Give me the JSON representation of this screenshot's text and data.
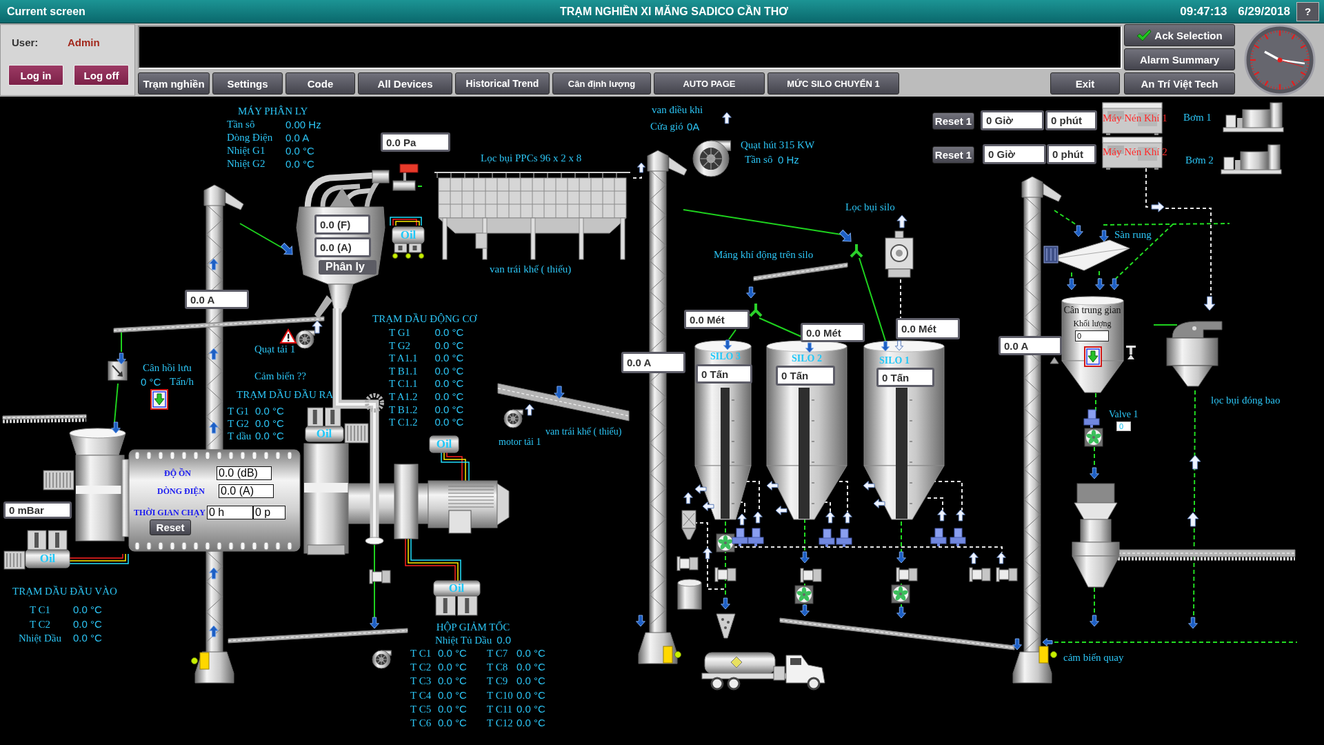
{
  "header": {
    "screen_label": "Current screen",
    "title": "TRẠM NGHIỀN XI MĂNG SADICO CẦN THƠ",
    "time": "09:47:13",
    "date": "6/29/2018",
    "help_button": "?"
  },
  "user_panel": {
    "user_label": "User:",
    "user_name": "Admin",
    "buttons": [
      "Log in",
      "Log off"
    ]
  },
  "nav_buttons": [
    "Trạm nghiền",
    "Settings",
    "Code",
    "All Devices",
    "Historical Trend",
    "Cân định lượng",
    "AUTO PAGE",
    "MỨC SILO CHUYỂN 1"
  ],
  "exit_button": "Exit",
  "side_buttons": [
    "Ack Selection",
    "Alarm Summary",
    "An Trí Việt Tech"
  ],
  "separator_panel": {
    "title": "MÁY PHÂN LY",
    "rows": [
      {
        "label": "Tần sô",
        "value": "0.00 Hz"
      },
      {
        "label": "Dòng Điện",
        "value": "0.0 A"
      },
      {
        "label": "Nhiệt G1",
        "value": "0.0 °C"
      },
      {
        "label": "Nhiệt G2",
        "value": "0.0 °C"
      }
    ]
  },
  "filter_pressure": "0.0 Pa",
  "separator": {
    "frequency": "0.0 (F)",
    "current": "0.0 (A)",
    "label": "Phân ly"
  },
  "oil_units": [
    "Oil",
    "Oil",
    "Oil",
    "Oil",
    "Oil"
  ],
  "elevators": [
    {
      "current": "0.0 A"
    },
    {
      "current": "0.0 A"
    },
    {
      "current": "0.0 A"
    }
  ],
  "canvas_labels": [
    "Lọc bụi PPCs 96 x 2 x 8",
    "van trái khế ( thiếu)",
    "Quạt tải 1",
    "Cảm biến ??",
    "van trái khế ( thiếu)",
    "motor tải 1",
    "Lọc bụi silo",
    "Máng khí động trên silo",
    "Sàn rung",
    "lọc bụi đóng bao",
    "cảm biến quay"
  ],
  "return_scale": {
    "title": "Cân hồi lưu",
    "value": "0 °C",
    "unit": "Tấn/h"
  },
  "motor_oil_station": {
    "title": "TRẠM DẦU ĐỘNG CƠ",
    "rows": [
      {
        "label": "T G1",
        "value": "0.0 °C"
      },
      {
        "label": "T G2",
        "value": "0.0 °C"
      },
      {
        "label": "T A1.1",
        "value": "0.0 °C"
      },
      {
        "label": "T B1.1",
        "value": "0.0 °C"
      },
      {
        "label": "T C1.1",
        "value": "0.0 °C"
      },
      {
        "label": "T A1.2",
        "value": "0.0 °C"
      },
      {
        "label": "T B1.2",
        "value": "0.0 °C"
      },
      {
        "label": "T C1.2",
        "value": "0.0 °C"
      }
    ]
  },
  "oil_outlet_station": {
    "title": "TRẠM DẦU ĐẦU RA",
    "rows": [
      {
        "label": "T G1",
        "value": "0.0 °C"
      },
      {
        "label": "T G2",
        "value": "0.0 °C"
      },
      {
        "label": "T dầu",
        "value": "0.0 °C"
      }
    ]
  },
  "mill": {
    "noise_label": "ĐỘ ỒN",
    "noise": "0.0 (dB)",
    "current_label": "DÒNG ĐIỆN",
    "current": "0.0 (A)",
    "runtime_label": "THỜI GIAN CHẠY",
    "runtime_hours": "0 h",
    "runtime_minutes": "0 p",
    "reset_button": "Reset"
  },
  "mill_pressure": "0 mBar",
  "oil_inlet_station": {
    "title": "TRẠM DẦU ĐẦU VÀO",
    "rows": [
      {
        "label": "T C1",
        "value": "0.0 °C"
      },
      {
        "label": "T C2",
        "value": "0.0 °C"
      },
      {
        "label": "Nhiệt Dầu",
        "value": "0.0 °C"
      }
    ]
  },
  "gearbox": {
    "title": "HỘP GIẢM TỐC",
    "tank_label": "Nhiệt Tủ Dầu",
    "tank_value": "0.0",
    "columns": [
      {
        "rows": [
          {
            "label": "T C1",
            "value": "0.0 °C"
          },
          {
            "label": "T C2",
            "value": "0.0 °C"
          },
          {
            "label": "T C3",
            "value": "0.0 °C"
          },
          {
            "label": "T C4",
            "value": "0.0 °C"
          },
          {
            "label": "T C5",
            "value": "0.0 °C"
          },
          {
            "label": "T C6",
            "value": "0.0 °C"
          }
        ]
      },
      {
        "rows": [
          {
            "label": "T C7",
            "value": "0.0 °C"
          },
          {
            "label": "T C8",
            "value": "0.0 °C"
          },
          {
            "label": "T C9",
            "value": "0.0 °C"
          },
          {
            "label": "T C10",
            "value": "0.0 °C"
          },
          {
            "label": "T C11",
            "value": "0.0 °C"
          },
          {
            "label": "T C12",
            "value": "0.0 °C"
          }
        ]
      }
    ]
  },
  "damper": {
    "title": "van điều khi",
    "label": "Cửa gió",
    "value": "0A"
  },
  "main_fan": {
    "title": "Quạt hút 315 KW",
    "label": "Tần sô",
    "value": "0 Hz"
  },
  "compressors": [
    {
      "name": "Máy Nén Khí 1",
      "reset_button": "Reset 1",
      "hours": "0 Giờ",
      "minutes": "0 phút"
    },
    {
      "name": "Máy Nén Khí 2",
      "reset_button": "Reset 1",
      "hours": "0 Giờ",
      "minutes": "0 phút"
    }
  ],
  "pumps": [
    "Bơm 1",
    "Bơm 2"
  ],
  "silos": [
    {
      "name": "SILO 3",
      "height_reading": "0.0 Mét",
      "weight": "0 Tấn"
    },
    {
      "name": "SILO 2",
      "height_reading": "0.0 Mét",
      "weight": "0 Tấn"
    },
    {
      "name": "SILO 1",
      "height_reading": "0.0 Mét",
      "weight": "0 Tấn"
    }
  ],
  "hopper_scale": {
    "title": "Cân trung gian",
    "weight_label": "Khối lượng",
    "weight": "0"
  },
  "valve": {
    "label": "Valve 1",
    "value": "0"
  }
}
